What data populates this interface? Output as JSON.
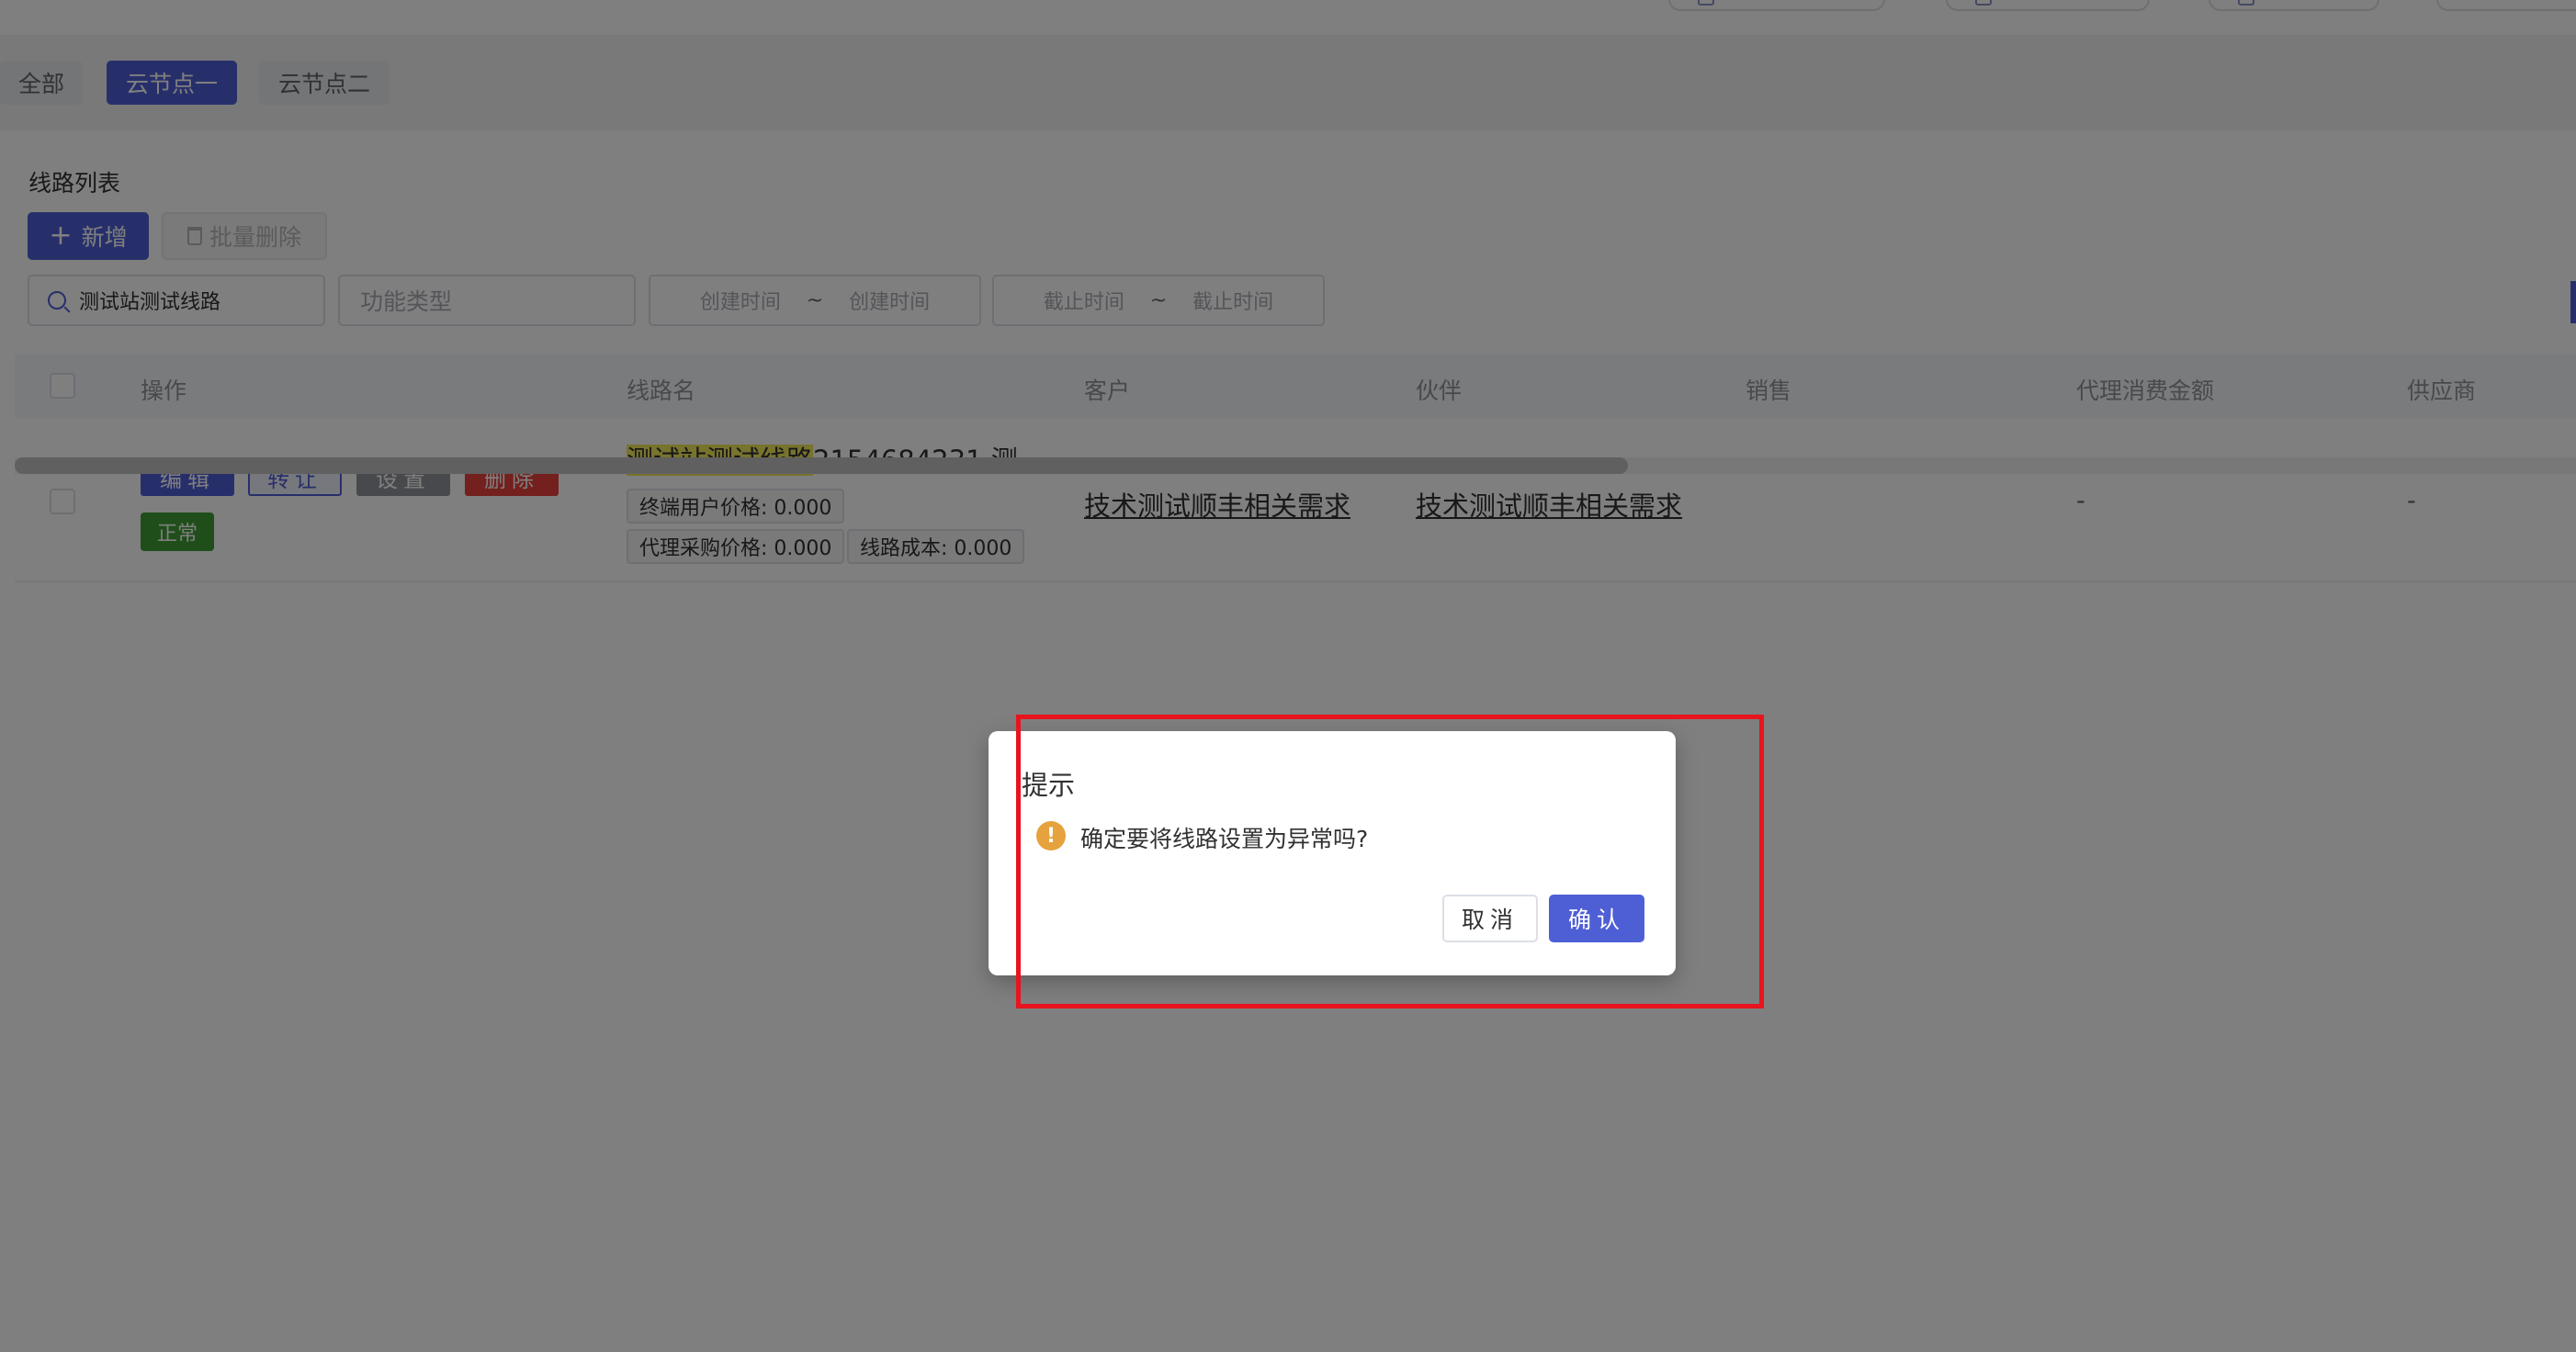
{
  "node_tabs": [
    {
      "label": "全部",
      "active": false
    },
    {
      "label": "云节点一",
      "active": true
    },
    {
      "label": "云节点二",
      "active": false
    }
  ],
  "list": {
    "title": "线路列表",
    "add_label": "新增",
    "batch_delete_label": "批量删除"
  },
  "filters": {
    "search_value": "测试站测试线路",
    "type_placeholder": "功能类型",
    "created": {
      "start_placeholder": "创建时间",
      "separator": "~",
      "end_placeholder": "创建时间"
    },
    "deadline": {
      "start_placeholder": "截止时间",
      "separator": "~",
      "end_placeholder": "截止时间"
    }
  },
  "table": {
    "headers": [
      "操作",
      "线路名",
      "客户",
      "伙伴",
      "销售",
      "代理消费金额",
      "供应商"
    ],
    "row": {
      "actions": [
        "编辑",
        "转让",
        "设置",
        "删除"
      ],
      "status": "正常",
      "line_name_highlight": "测试站测试线路",
      "line_name_rest": "2154684231 测...",
      "end_user_price": "终端用户价格: 0.000",
      "agent_purchase_price": "代理采购价格: 0.000",
      "line_cost": "线路成本: 0.000",
      "customer": "技术测试顺丰相关需求",
      "partner": "技术测试顺丰相关需求",
      "agent_amount": "-",
      "supplier": "-"
    }
  },
  "dialog": {
    "title": "提示",
    "message": "确定要将线路设置为异常吗?",
    "cancel_label": "取消",
    "confirm_label": "确认"
  },
  "colors": {
    "primary": "#4e5fd6",
    "danger": "#e6403d",
    "success": "#3f9c35",
    "warning": "#e6a23c",
    "annotation_box": "#e8141e"
  }
}
